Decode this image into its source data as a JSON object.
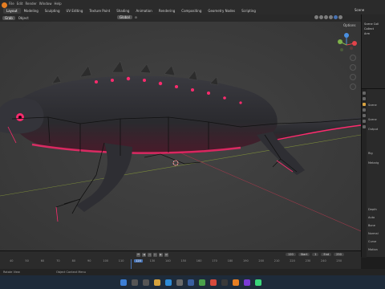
{
  "topbar": {
    "menu": [
      "File",
      "Edit",
      "Render",
      "Window",
      "Help"
    ],
    "workspaces": [
      "Layout",
      "Modeling",
      "Sculpting",
      "UV Editing",
      "Texture Paint",
      "Shading",
      "Animation",
      "Rendering",
      "Compositing",
      "Geometry Nodes",
      "Scripting"
    ],
    "active_workspace": "Layout",
    "scene_label": "Scene"
  },
  "viewport_header": {
    "mode_label": "Grab",
    "object_menu": "Object",
    "transform_orientation": "Global",
    "options_label": "Options"
  },
  "outliner": {
    "rows": [
      "Scene Coll",
      "Collect",
      "Arm"
    ]
  },
  "properties": {
    "header": "Scene",
    "rows": [
      "Scene",
      "Output",
      "Rig",
      "Metarig",
      "Camera",
      "Depth",
      "Auto",
      "Bone",
      "Normal",
      "Curve",
      "Motion",
      "Display"
    ]
  },
  "timeline": {
    "current_frame": "120",
    "start_label": "Start",
    "start": "1",
    "end_label": "End",
    "end": "250",
    "ticks": [
      "40",
      "50",
      "60",
      "70",
      "80",
      "90",
      "100",
      "110",
      "120",
      "130",
      "140",
      "150",
      "160",
      "170",
      "180",
      "190",
      "200",
      "210",
      "220",
      "230",
      "240",
      "250"
    ]
  },
  "statusbar": {
    "left": "Rotate View",
    "middle": "Object Context Menu"
  },
  "colors": {
    "accent": "#4772b3",
    "creature_glow": "#ff2b6e"
  }
}
